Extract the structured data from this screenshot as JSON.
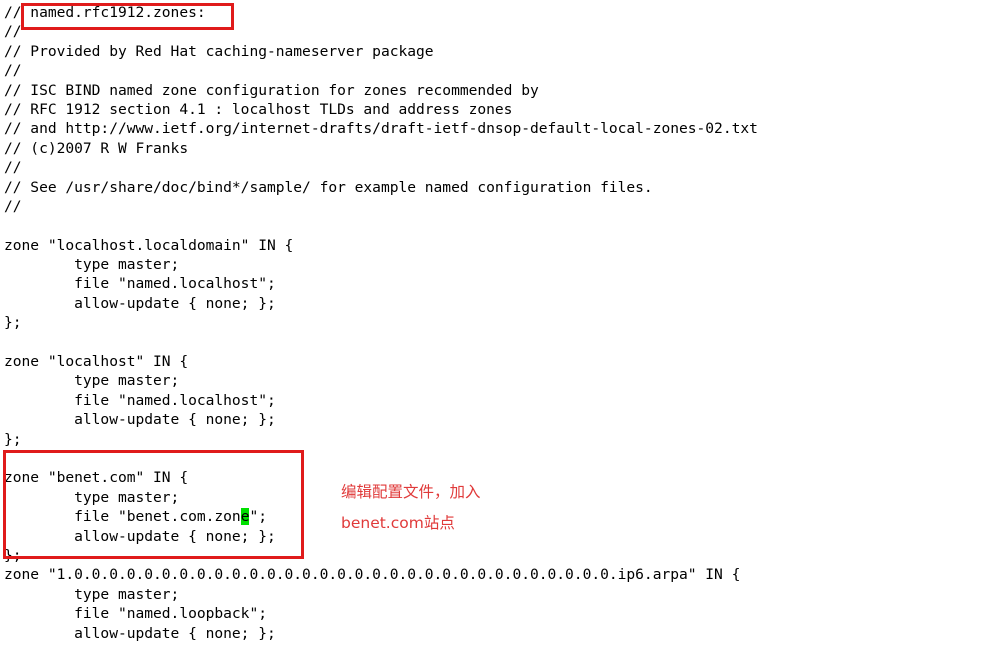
{
  "window": {
    "background_color": "#ffffff",
    "text_color": "#000000"
  },
  "file": {
    "name": "named.rfc1912.zones"
  },
  "annotations": {
    "box_color": "#e01b1b",
    "text_color": "#e03a3a",
    "cursor_color": "#00e000",
    "note_line_1": "编辑配置文件，加入",
    "note_line_2": "benet.com站点"
  },
  "code": {
    "lines": [
      "// named.rfc1912.zones:",
      "//",
      "// Provided by Red Hat caching-nameserver package",
      "//",
      "// ISC BIND named zone configuration for zones recommended by",
      "// RFC 1912 section 4.1 : localhost TLDs and address zones",
      "// and http://www.ietf.org/internet-drafts/draft-ietf-dnsop-default-local-zones-02.txt",
      "// (c)2007 R W Franks",
      "//",
      "// See /usr/share/doc/bind*/sample/ for example named configuration files.",
      "//",
      "",
      "zone \"localhost.localdomain\" IN {",
      "        type master;",
      "        file \"named.localhost\";",
      "        allow-update { none; };",
      "};",
      "",
      "zone \"localhost\" IN {",
      "        type master;",
      "        file \"named.localhost\";",
      "        allow-update { none; };",
      "};",
      "",
      "zone \"benet.com\" IN {",
      "        type master;",
      "        file \"benet.com.zone\";",
      "        allow-update { none; };",
      "};",
      "zone \"1.0.0.0.0.0.0.0.0.0.0.0.0.0.0.0.0.0.0.0.0.0.0.0.0.0.0.0.0.0.0.0.ip6.arpa\" IN {",
      "        type master;",
      "        file \"named.loopback\";",
      "        allow-update { none; };",
      "};"
    ],
    "cursor": {
      "line_index": 26,
      "char": "e",
      "prefix": "        file \"benet.com.zon",
      "suffix": "\";"
    }
  }
}
